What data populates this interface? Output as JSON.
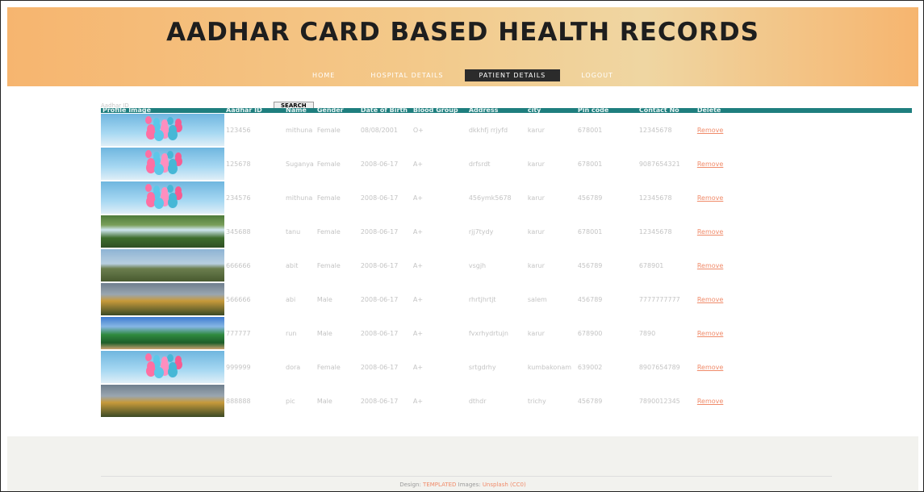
{
  "site_title": "AADHAR CARD BASED HEALTH RECORDS",
  "nav": [
    {
      "label": "HOME",
      "active": false
    },
    {
      "label": "HOSPITAL DETAILS",
      "active": false
    },
    {
      "label": "PATIENT DETAILS",
      "active": true
    },
    {
      "label": "LOGOUT",
      "active": false
    }
  ],
  "search": {
    "placeholder": "Aadhar ID",
    "button": "SEARCH"
  },
  "table": {
    "headers": [
      "Profile Image",
      "Aadhar ID",
      "Name",
      "Gender",
      "Date of Birth",
      "Blood Group",
      "Address",
      "city",
      "Pin code",
      "Contact No",
      "Delete"
    ],
    "rows": [
      {
        "image": "balloons",
        "aadhar": "123456",
        "name": "mithuna",
        "gender": "Female",
        "dob": "08/08/2001",
        "blood": "O+",
        "address": "dkkhfj rrjyfd",
        "city": "karur",
        "pin": "678001",
        "contact": "12345678",
        "delete": "Remove"
      },
      {
        "image": "balloons-sky",
        "aadhar": "125678",
        "name": "Suganya",
        "gender": "Female",
        "dob": "2008-06-17",
        "blood": "A+",
        "address": "drfsrdt",
        "city": "karur",
        "pin": "678001",
        "contact": "9087654321",
        "delete": "Remove"
      },
      {
        "image": "balloons",
        "aadhar": "234576",
        "name": "mithuna",
        "gender": "Female",
        "dob": "2008-06-17",
        "blood": "A+",
        "address": "456ymk5678",
        "city": "karur",
        "pin": "456789",
        "contact": "12345678",
        "delete": "Remove"
      },
      {
        "image": "waterfall",
        "aadhar": "345688",
        "name": "tanu",
        "gender": "Female",
        "dob": "2008-06-17",
        "blood": "A+",
        "address": "rjj7tydy",
        "city": "karur",
        "pin": "678001",
        "contact": "12345678",
        "delete": "Remove"
      },
      {
        "image": "field",
        "aadhar": "666666",
        "name": "abit",
        "gender": "Female",
        "dob": "2008-06-17",
        "blood": "A+",
        "address": "vsgjh",
        "city": "karur",
        "pin": "456789",
        "contact": "678901",
        "delete": "Remove"
      },
      {
        "image": "sunflowers",
        "aadhar": "566666",
        "name": "abi",
        "gender": "Male",
        "dob": "2008-06-17",
        "blood": "A+",
        "address": "rhrtjhrtjt",
        "city": "salem",
        "pin": "456789",
        "contact": "7777777777",
        "delete": "Remove"
      },
      {
        "image": "river",
        "aadhar": "777777",
        "name": "run",
        "gender": "Male",
        "dob": "2008-06-17",
        "blood": "A+",
        "address": "fvxrhydrtujn",
        "city": "karur",
        "pin": "678900",
        "contact": "7890",
        "delete": "Remove"
      },
      {
        "image": "balloons-sky",
        "aadhar": "999999",
        "name": "dora",
        "gender": "Female",
        "dob": "2008-06-17",
        "blood": "A+",
        "address": "srtgdrhy",
        "city": "kumbakonam",
        "pin": "639002",
        "contact": "8907654789",
        "delete": "Remove"
      },
      {
        "image": "sunflowers",
        "aadhar": "888888",
        "name": "pic",
        "gender": "Male",
        "dob": "2008-06-17",
        "blood": "A+",
        "address": "dthdr",
        "city": "trichy",
        "pin": "456789",
        "contact": "7890012345",
        "delete": "Remove"
      }
    ]
  },
  "footer": {
    "design_label": "Design:",
    "design_link": "TEMPLATED",
    "images_label": "Images:",
    "images_link": "Unsplash (CC0)"
  },
  "colors": {
    "header_bg": "#f3c98a",
    "table_header": "#1e7e7e",
    "link": "#f08b6a",
    "nav_active_bg": "#2b2b2b"
  }
}
